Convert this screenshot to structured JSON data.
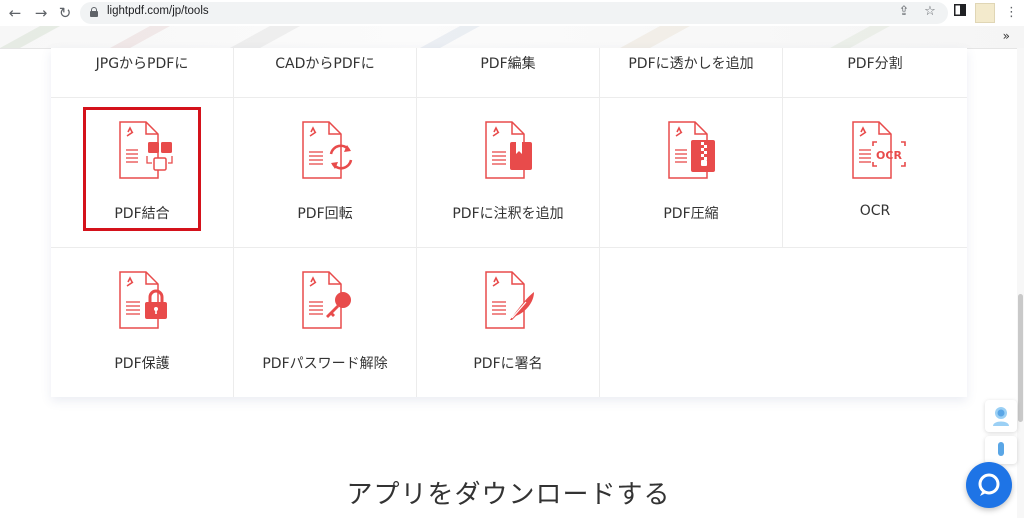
{
  "browser": {
    "url": "lightpdf.com/jp/tools",
    "more_bookmarks": "»"
  },
  "tools": {
    "row1": [
      "JPGからPDFに",
      "CADからPDFに",
      "PDF編集",
      "PDFに透かしを追加",
      "PDF分割"
    ],
    "row2": [
      {
        "label": "PDF結合",
        "icon": "merge-icon",
        "selected": true
      },
      {
        "label": "PDF回転",
        "icon": "rotate-icon"
      },
      {
        "label": "PDFに注釈を追加",
        "icon": "annotate-icon"
      },
      {
        "label": "PDF圧縮",
        "icon": "compress-icon"
      },
      {
        "label": "OCR",
        "icon": "ocr-icon"
      }
    ],
    "row3": [
      {
        "label": "PDF保護",
        "icon": "lock-icon"
      },
      {
        "label": "PDFパスワード解除",
        "icon": "key-icon"
      },
      {
        "label": "PDFに署名",
        "icon": "sign-icon"
      }
    ]
  },
  "ocr_badge": "OCR",
  "app_download_heading": "アプリをダウンロードする",
  "colors": {
    "accent": "#e84b4b",
    "selection": "#d4121b",
    "chat": "#1e74e6"
  }
}
